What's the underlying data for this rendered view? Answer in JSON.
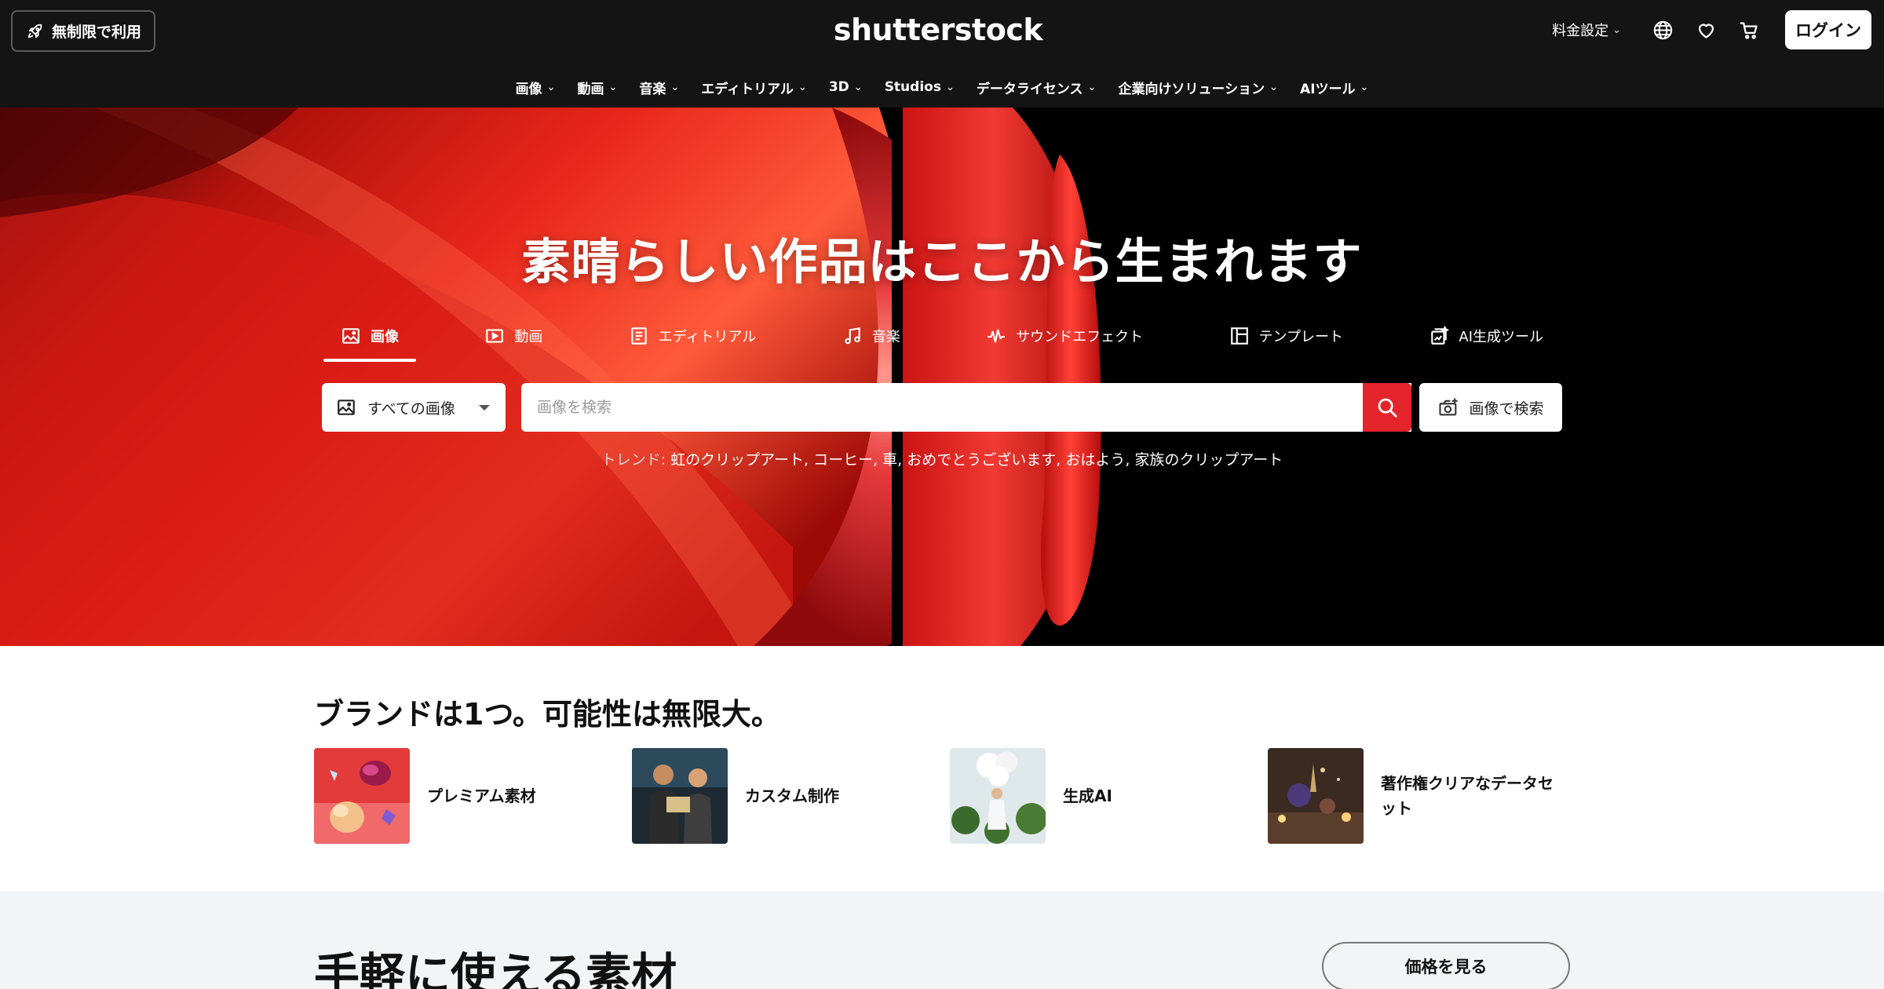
{
  "header": {
    "unlimited_label": "無制限で利用",
    "logo_text": "shutterstock",
    "pricing_label": "料金設定",
    "login_label": "ログイン",
    "icons": [
      "rocket-icon",
      "globe-icon",
      "heart-icon",
      "cart-icon"
    ]
  },
  "nav": {
    "items": [
      {
        "label": "画像"
      },
      {
        "label": "動画"
      },
      {
        "label": "音楽"
      },
      {
        "label": "エディトリアル"
      },
      {
        "label": "3D"
      },
      {
        "label": "Studios"
      },
      {
        "label": "データライセンス"
      },
      {
        "label": "企業向けソリューション"
      },
      {
        "label": "AIツール"
      }
    ]
  },
  "hero": {
    "title": "素晴らしい作品はここから生まれます",
    "tabs": [
      {
        "label": "画像",
        "icon": "image-icon",
        "active": true
      },
      {
        "label": "動画",
        "icon": "video-icon"
      },
      {
        "label": "エディトリアル",
        "icon": "editorial-icon"
      },
      {
        "label": "音楽",
        "icon": "music-icon"
      },
      {
        "label": "サウンドエフェクト",
        "icon": "waveform-icon"
      },
      {
        "label": "テンプレート",
        "icon": "template-icon"
      },
      {
        "label": "AI生成ツール",
        "icon": "ai-generate-icon"
      }
    ],
    "type_select_value": "すべての画像",
    "search_placeholder": "画像を検索",
    "image_search_label": "画像で検索",
    "trends_label": "トレンド:",
    "trends_items": "虹のクリップアート, コーヒー, 車, おめでとうございます, おはよう, 家族のクリップアート"
  },
  "brand": {
    "title": "ブランドは1つ。可能性は無限大。",
    "features": [
      {
        "label": "プレミアム素材"
      },
      {
        "label": "カスタム制作"
      },
      {
        "label": "生成AI"
      },
      {
        "label": "著作権クリアなデータセット"
      }
    ]
  },
  "easy": {
    "title": "手軽に使える素材",
    "pricing_button": "価格を見る"
  },
  "colors": {
    "header_bg": "#141414",
    "accent_red": "#e3242b",
    "lower_band_bg": "#f3f4f5"
  }
}
